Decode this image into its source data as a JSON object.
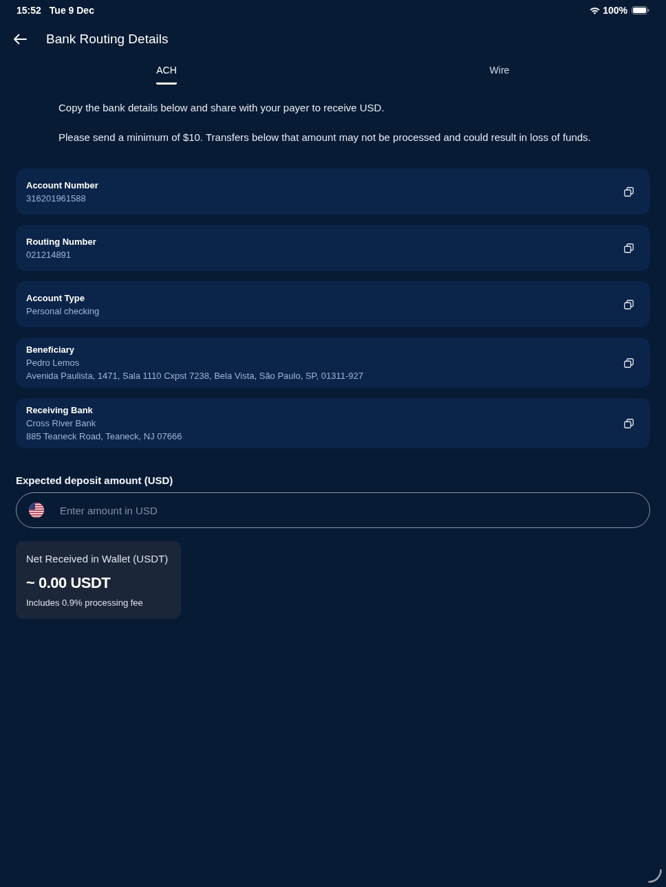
{
  "status_bar": {
    "time": "15:52",
    "date": "Tue 9 Dec",
    "battery": "100%"
  },
  "header": {
    "title": "Bank Routing Details"
  },
  "tabs": [
    {
      "label": "ACH",
      "selected": true
    },
    {
      "label": "Wire",
      "selected": false
    }
  ],
  "instructions": [
    "Copy the bank details below and share with your payer to receive USD.",
    "Please send a minimum of $10. Transfers below that amount may not be processed and could result in loss of funds."
  ],
  "details": [
    {
      "label": "Account Number",
      "lines": [
        "316201961588"
      ]
    },
    {
      "label": "Routing Number",
      "lines": [
        "021214891"
      ]
    },
    {
      "label": "Account Type",
      "lines": [
        "Personal checking"
      ]
    },
    {
      "label": "Beneficiary",
      "lines": [
        "Pedro Lemos",
        "Avenida Paulista, 1471, Sala 1110 Cxpst 7238, Bela Vista, São Paulo, SP, 01311-927"
      ]
    },
    {
      "label": "Receiving Bank",
      "lines": [
        "Cross River Bank",
        "885 Teaneck Road, Teaneck, NJ 07666"
      ]
    }
  ],
  "deposit": {
    "label": "Expected deposit amount (USD)",
    "placeholder": "Enter amount in USD"
  },
  "net_received": {
    "title": "Net Received in Wallet (USDT)",
    "amount": "~ 0.00 USDT",
    "note": "Includes 0.9% processing fee"
  }
}
